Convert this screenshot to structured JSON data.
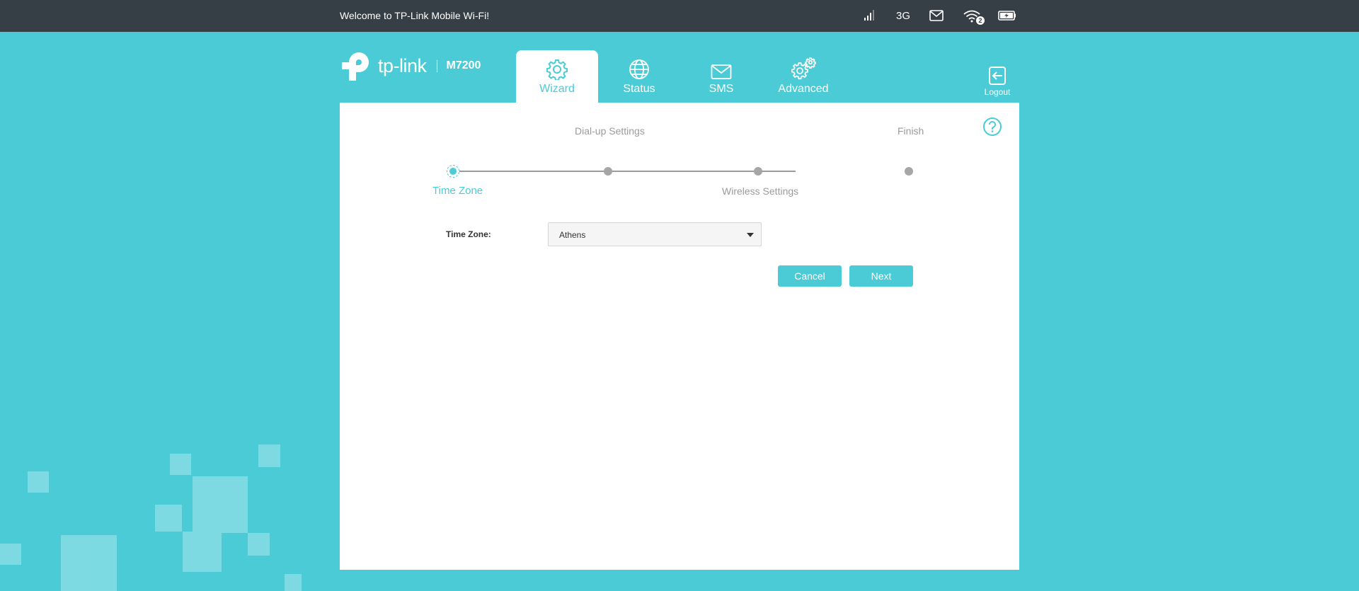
{
  "topbar": {
    "welcome": "Welcome to TP-Link Mobile Wi-Fi!",
    "network_type": "3G",
    "wifi_clients": "2"
  },
  "brand": {
    "logo_text": "tp-link",
    "model": "M7200"
  },
  "nav": {
    "tabs": [
      {
        "label": "Wizard",
        "icon": "gear-icon",
        "active": true
      },
      {
        "label": "Status",
        "icon": "globe-icon",
        "active": false
      },
      {
        "label": "SMS",
        "icon": "envelope-icon",
        "active": false
      },
      {
        "label": "Advanced",
        "icon": "gears-icon",
        "active": false
      }
    ],
    "logout": "Logout"
  },
  "wizard": {
    "steps": [
      {
        "label": "Time Zone",
        "active": true
      },
      {
        "label": "Dial-up Settings",
        "active": false
      },
      {
        "label": "Wireless Settings",
        "active": false
      },
      {
        "label": "Finish",
        "active": false
      }
    ],
    "timezone_label": "Time Zone:",
    "timezone_value": "Athens",
    "cancel_label": "Cancel",
    "next_label": "Next"
  },
  "colors": {
    "accent": "#4acbd6",
    "topbar_bg": "#363f45",
    "step_inactive": "#9b9b9b"
  }
}
